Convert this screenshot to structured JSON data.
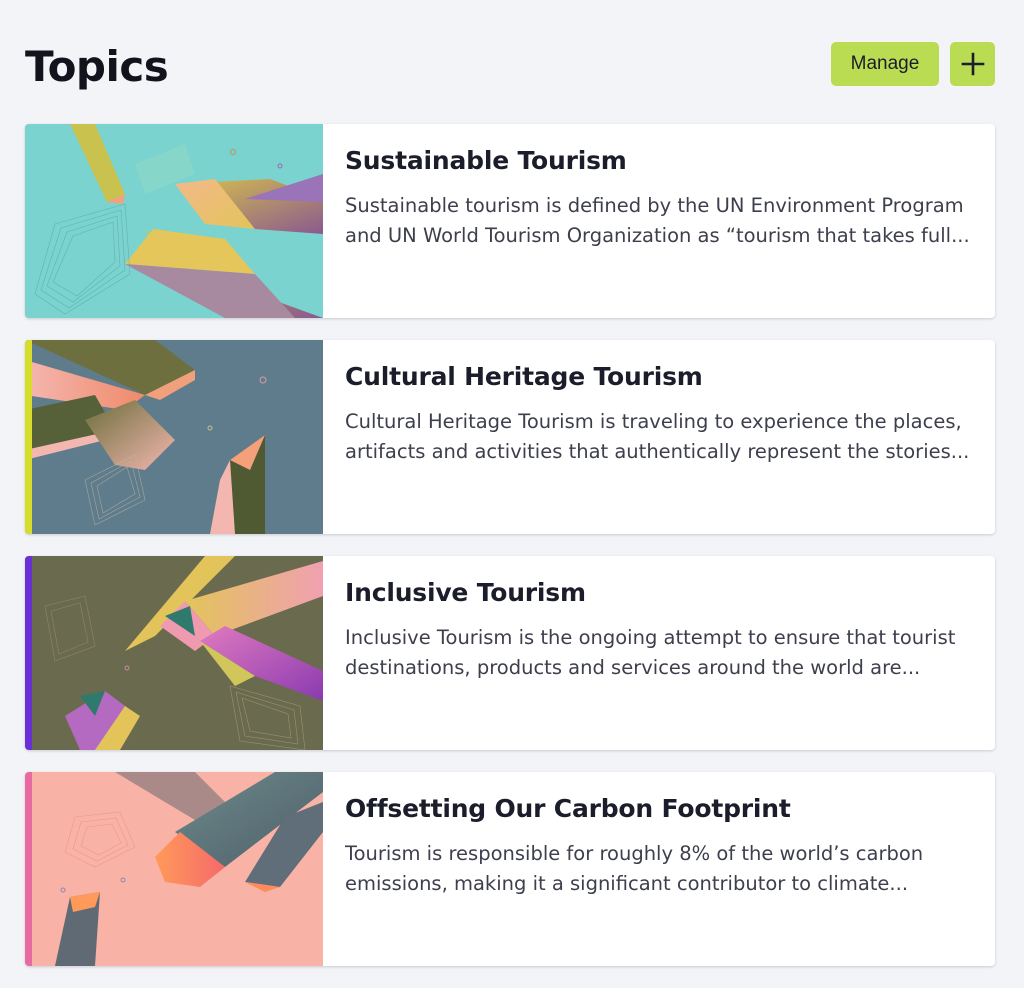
{
  "header": {
    "title": "Topics",
    "manage_label": "Manage",
    "add_icon": "plus-icon",
    "button_color": "#b9dc52"
  },
  "topics": [
    {
      "title": "Sustainable Tourism",
      "description": "Sustainable tourism is defined by the UN Environment Program and UN World Tourism Organization as “tourism that takes full...",
      "accent_color": "#7ad3cf",
      "image_bg": "#7ad3cf"
    },
    {
      "title": "Cultural Heritage Tourism",
      "description": "Cultural Heritage Tourism is traveling to experience the places, artifacts and activities that authentically represent the stories...",
      "accent_color": "#d6dd2a",
      "image_bg": "#5f7c8c"
    },
    {
      "title": "Inclusive Tourism",
      "description": "Inclusive Tourism is the ongoing attempt to ensure that tourist destinations, products and services around the world are...",
      "accent_color": "#6a2fd6",
      "image_bg": "#6a6a4f"
    },
    {
      "title": "Offsetting Our Carbon Footprint",
      "description": "Tourism is responsible for roughly 8% of the world’s carbon emissions, making it a significant contributor to climate...",
      "accent_color": "#e86aa0",
      "image_bg": "#f9b2a6"
    }
  ]
}
